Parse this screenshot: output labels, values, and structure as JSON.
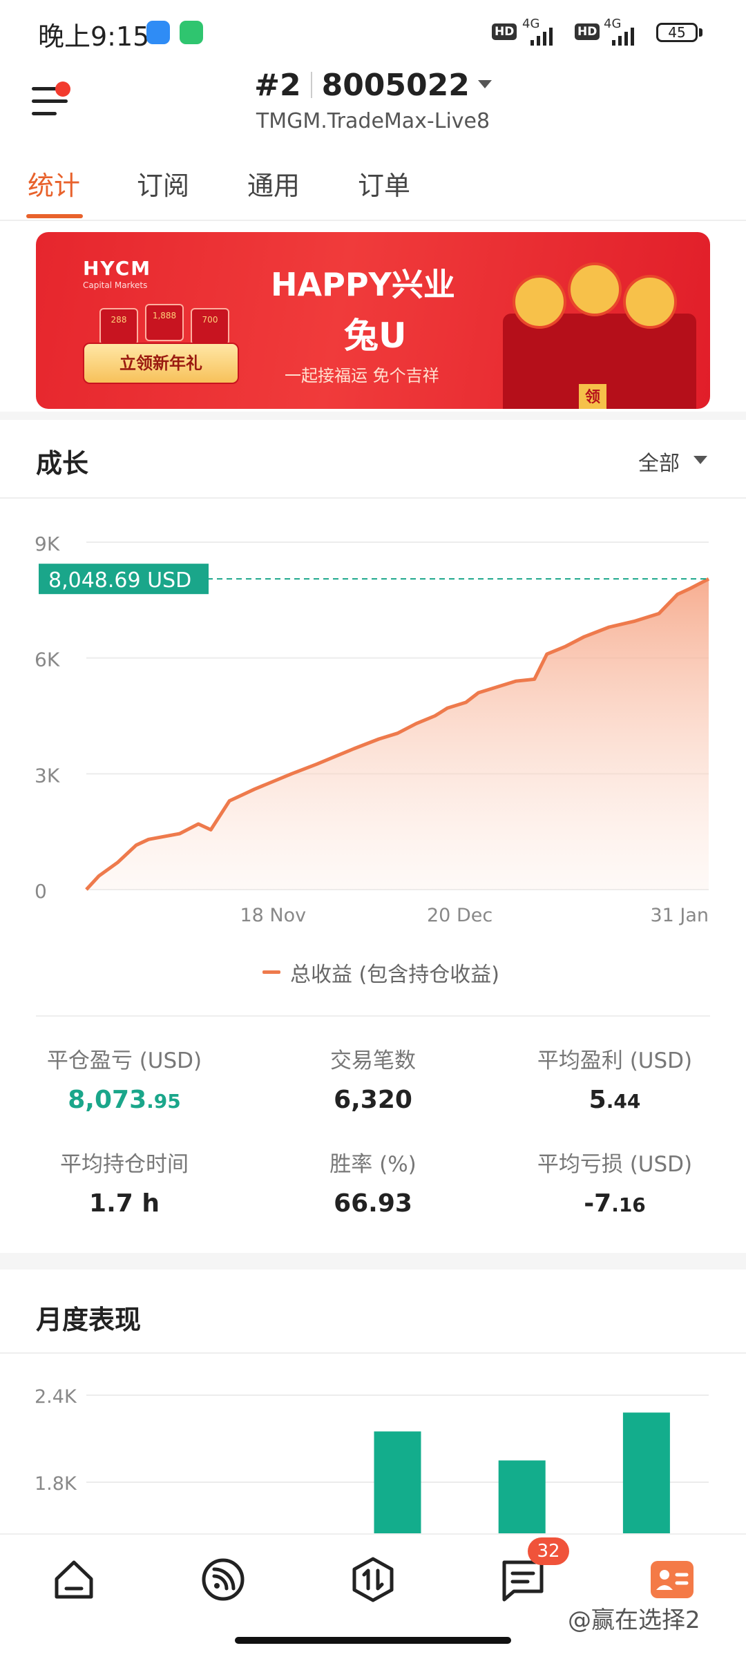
{
  "status_bar": {
    "time": "晚上9:15",
    "hd1": "HD",
    "net1": "4G",
    "hd2": "HD",
    "net2": "4G",
    "battery": "45"
  },
  "header": {
    "account_index": "#2",
    "account_number": "8005022",
    "server": "TMGM.TradeMax-Live8"
  },
  "tabs": [
    {
      "label": "统计",
      "active": true
    },
    {
      "label": "订阅",
      "active": false
    },
    {
      "label": "通用",
      "active": false
    },
    {
      "label": "订单",
      "active": false
    }
  ],
  "banner": {
    "logo": "HYCM",
    "logo_sub": "Capital Markets",
    "card_values": [
      "288",
      "1,888",
      "700"
    ],
    "button_label": "立领新年礼",
    "headline": "HAPPY兴业",
    "headline2": "兔U",
    "subline": "一起接福运 免个吉祥",
    "gift_tag": "领"
  },
  "growth": {
    "title": "成长",
    "filter": "全部",
    "legend": "总收益 (包含持仓收益)",
    "current_value_label": "8,048.69 USD",
    "line_color": "#ee7a4c",
    "label_color": "#1aa68a"
  },
  "stats": [
    {
      "label": "平仓盈亏 (USD)",
      "value_main": "8,073",
      "value_dec": ".95",
      "positive": true
    },
    {
      "label": "交易笔数",
      "value_main": "6,320",
      "value_dec": "",
      "positive": false
    },
    {
      "label": "平均盈利 (USD)",
      "value_main": "5",
      "value_dec": ".44",
      "positive": false
    },
    {
      "label": "平均持仓时间",
      "value_main": "1.7 h",
      "value_dec": "",
      "positive": false
    },
    {
      "label": "胜率 (%)",
      "value_main": "66.93",
      "value_dec": "",
      "positive": false
    },
    {
      "label": "平均亏损 (USD)",
      "value_main": "-7",
      "value_dec": ".16",
      "positive": false
    }
  ],
  "monthly": {
    "title": "月度表现",
    "bar_color": "#13ad8c"
  },
  "bottom_nav": {
    "items": [
      "home-icon",
      "feed-icon",
      "trade-icon",
      "messages-icon",
      "profile-icon"
    ],
    "badge": "32",
    "watermark": "@赢在选择2"
  },
  "chart_data": [
    {
      "type": "area",
      "title": "",
      "xlabel": "",
      "ylabel": "",
      "ylim": [
        0,
        9000
      ],
      "y_ticks": [
        "0",
        "3K",
        "6K",
        "9K"
      ],
      "x_ticks": [
        {
          "label": "18 Nov",
          "x": 0.3
        },
        {
          "label": "20 Dec",
          "x": 0.6
        },
        {
          "label": "31 Jan",
          "x": 1.0
        }
      ],
      "reference_value": 8048.69,
      "reference_label": "8,048.69 USD",
      "series": [
        {
          "name": "总收益 (包含持仓收益)",
          "x": [
            0,
            0.02,
            0.05,
            0.08,
            0.1,
            0.15,
            0.18,
            0.2,
            0.23,
            0.25,
            0.27,
            0.3,
            0.33,
            0.37,
            0.4,
            0.43,
            0.47,
            0.5,
            0.53,
            0.56,
            0.58,
            0.61,
            0.63,
            0.66,
            0.69,
            0.72,
            0.74,
            0.77,
            0.8,
            0.84,
            0.88,
            0.92,
            0.95,
            0.97,
            1.0
          ],
          "values": [
            0,
            350,
            700,
            1150,
            1300,
            1450,
            1700,
            1550,
            2300,
            2450,
            2600,
            2800,
            3000,
            3250,
            3450,
            3650,
            3900,
            4050,
            4300,
            4500,
            4700,
            4850,
            5100,
            5250,
            5400,
            5450,
            6100,
            6300,
            6550,
            6800,
            6950,
            7150,
            7650,
            7800,
            8049
          ]
        }
      ]
    },
    {
      "type": "bar",
      "title": "",
      "y_ticks": [
        "1.8K",
        "2.4K"
      ],
      "categories": [
        "",
        "",
        "",
        "",
        ""
      ],
      "values": [
        null,
        null,
        2150,
        1950,
        2280
      ]
    }
  ]
}
